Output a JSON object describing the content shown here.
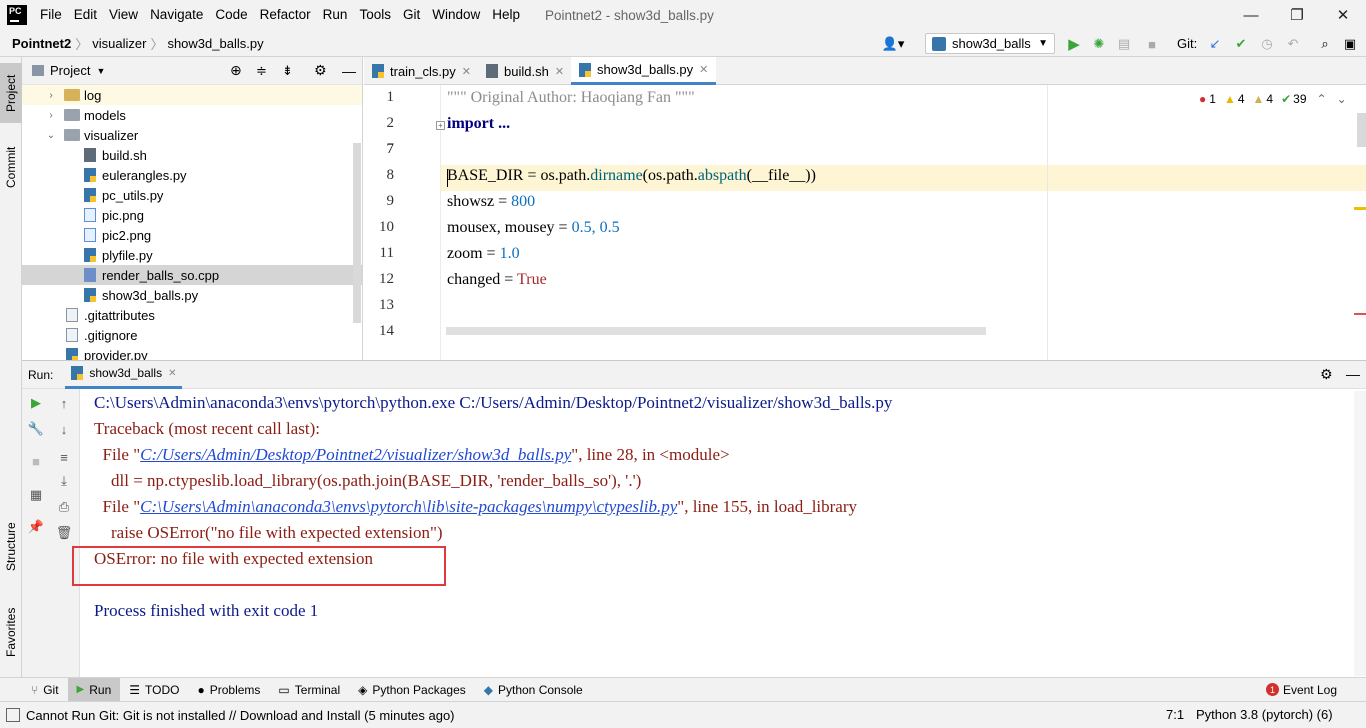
{
  "menubar": {
    "items": [
      "File",
      "Edit",
      "View",
      "Navigate",
      "Code",
      "Refactor",
      "Run",
      "Tools",
      "Git",
      "Window",
      "Help"
    ],
    "title": "Pointnet2 - show3d_balls.py"
  },
  "navbar": {
    "breadcrumbs": [
      "Pointnet2",
      "visualizer",
      "show3d_balls.py"
    ],
    "run_config": "show3d_balls",
    "git_label": "Git:"
  },
  "left_strip": {
    "tabs": [
      "Project",
      "Commit",
      "Structure",
      "Favorites"
    ]
  },
  "project": {
    "title": "Project",
    "tree": [
      {
        "name": "log",
        "kind": "folder",
        "depth": 1,
        "arrow": "›"
      },
      {
        "name": "models",
        "kind": "folder",
        "depth": 1,
        "arrow": "›"
      },
      {
        "name": "visualizer",
        "kind": "folder",
        "depth": 1,
        "arrow": "⌄"
      },
      {
        "name": "build.sh",
        "kind": "sh",
        "depth": 2
      },
      {
        "name": "eulerangles.py",
        "kind": "py",
        "depth": 2
      },
      {
        "name": "pc_utils.py",
        "kind": "py",
        "depth": 2
      },
      {
        "name": "pic.png",
        "kind": "img",
        "depth": 2
      },
      {
        "name": "pic2.png",
        "kind": "img",
        "depth": 2
      },
      {
        "name": "plyfile.py",
        "kind": "py",
        "depth": 2
      },
      {
        "name": "render_balls_so.cpp",
        "kind": "cpp",
        "depth": 2,
        "selected": true
      },
      {
        "name": "show3d_balls.py",
        "kind": "py",
        "depth": 2
      },
      {
        "name": ".gitattributes",
        "kind": "txt",
        "depth": 1
      },
      {
        "name": ".gitignore",
        "kind": "txt",
        "depth": 1
      },
      {
        "name": "provider.py",
        "kind": "py",
        "depth": 1
      }
    ]
  },
  "editor": {
    "tabs": [
      {
        "label": "train_cls.py",
        "active": false
      },
      {
        "label": "build.sh",
        "active": false
      },
      {
        "label": "show3d_balls.py",
        "active": true
      }
    ],
    "inspection": {
      "errors": "1",
      "warnings": "4",
      "weak": "4",
      "typos": "39"
    },
    "line_numbers": [
      "1",
      "2",
      "7",
      "8",
      "9",
      "10",
      "11",
      "12",
      "13",
      "14"
    ],
    "code": {
      "l1": "\"\"\" Original Author: Haoqiang Fan \"\"\"",
      "l2": "import ...",
      "l8a": "BASE_DIR = os.path.",
      "l8b": "dirname",
      "l8c": "(os.path.",
      "l8d": "abspath",
      "l8e": "(__file__))",
      "l9a": "showsz = ",
      "l9b": "800",
      "l10a": "mousex, mousey = ",
      "l10b": "0.5, 0.5",
      "l11a": "zoom = ",
      "l11b": "1.0",
      "l12a": "changed = ",
      "l12b": "True"
    }
  },
  "run": {
    "label": "Run:",
    "tab": "show3d_balls",
    "console": {
      "cmd": "C:\\Users\\Admin\\anaconda3\\envs\\pytorch\\python.exe C:/Users/Admin/Desktop/Pointnet2/visualizer/show3d_balls.py",
      "tb": "Traceback (most recent call last):",
      "f1a": "  File \"",
      "f1link": "C:/Users/Admin/Desktop/Pointnet2/visualizer/show3d_balls.py",
      "f1b": "\", line 28, in <module>",
      "dll": "    dll = np.ctypeslib.load_library(os.path.join(BASE_DIR, 'render_balls_so'), '.')",
      "f2a": "  File \"",
      "f2link": "C:\\Users\\Admin\\anaconda3\\envs\\pytorch\\lib\\site-packages\\numpy\\ctypeslib.py",
      "f2b": "\", line 155, in load_library",
      "raise": "    raise OSError(\"no file with expected extension\")",
      "error": "OSError: no file with expected extension",
      "exit": "Process finished with exit code 1"
    }
  },
  "bottom_tabs": [
    "Git",
    "Run",
    "TODO",
    "Problems",
    "Terminal",
    "Python Packages",
    "Python Console"
  ],
  "event_log": {
    "count": "1",
    "label": "Event Log"
  },
  "status": {
    "message": "Cannot Run Git: Git is not installed // Download and Install (5 minutes ago)",
    "position": "7:1",
    "interpreter": "Python 3.8 (pytorch) (6)"
  }
}
